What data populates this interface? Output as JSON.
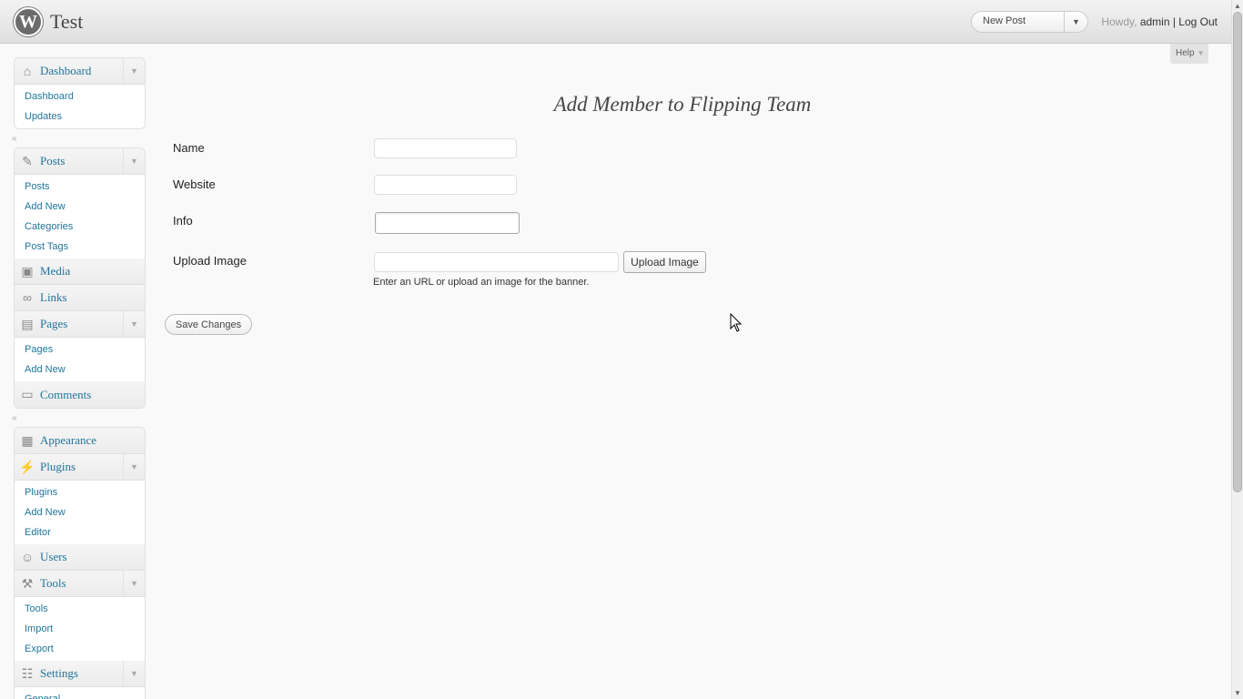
{
  "header": {
    "site_title": "Test",
    "favorite_action": "New Post",
    "greeting": "Howdy, ",
    "username": "admin",
    "separator": " | ",
    "logout": "Log Out",
    "logo_letter": "W"
  },
  "help": {
    "label": "Help"
  },
  "sidebar": {
    "dashboard": {
      "label": "Dashboard",
      "items": [
        "Dashboard",
        "Updates"
      ]
    },
    "posts": {
      "label": "Posts",
      "items": [
        "Posts",
        "Add New",
        "Categories",
        "Post Tags"
      ]
    },
    "media": {
      "label": "Media"
    },
    "links": {
      "label": "Links"
    },
    "pages": {
      "label": "Pages",
      "items": [
        "Pages",
        "Add New"
      ]
    },
    "comments": {
      "label": "Comments"
    },
    "appearance": {
      "label": "Appearance"
    },
    "plugins": {
      "label": "Plugins",
      "items": [
        "Plugins",
        "Add New",
        "Editor"
      ]
    },
    "users": {
      "label": "Users"
    },
    "tools": {
      "label": "Tools",
      "items": [
        "Tools",
        "Import",
        "Export"
      ]
    },
    "settings": {
      "label": "Settings",
      "items": [
        "General"
      ]
    }
  },
  "main": {
    "title": "Add Member to Flipping Team",
    "fields": {
      "name": {
        "label": "Name",
        "value": ""
      },
      "website": {
        "label": "Website",
        "value": ""
      },
      "info": {
        "label": "Info",
        "value": ""
      },
      "upload": {
        "label": "Upload Image",
        "value": "",
        "button": "Upload Image",
        "hint": "Enter an URL or upload an image for the banner."
      }
    },
    "save_label": "Save Changes"
  },
  "colors": {
    "link": "#21759b",
    "background": "#f9f9f9",
    "header_bg": "#e4e4e4"
  }
}
